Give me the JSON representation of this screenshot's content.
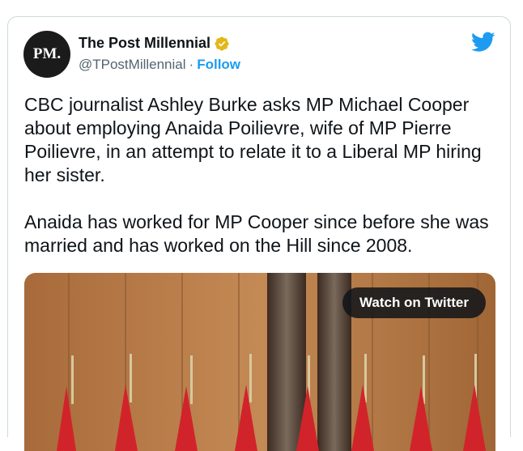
{
  "author": {
    "avatar_text": "PM.",
    "name": "The Post Millennial",
    "handle": "@TPostMillennial",
    "separator": "·",
    "follow_label": "Follow",
    "verified_color": "#e2b719"
  },
  "tweet": {
    "text": "CBC journalist Ashley Burke asks MP Michael Cooper about employing Anaida Poilievre, wife of MP Pierre Poilievre, in an attempt to relate it to a Liberal MP hiring her sister.\n\nAnaida has worked for MP Cooper since before she was married and has worked on the Hill since 2008."
  },
  "media": {
    "watch_label": "Watch on Twitter"
  },
  "colors": {
    "twitter_blue": "#1d9bf0",
    "text": "#0f1419",
    "muted": "#536471",
    "border": "#cfd9de"
  },
  "icons": {
    "brand": "twitter-bird-icon",
    "verified": "verified-badge-icon"
  }
}
